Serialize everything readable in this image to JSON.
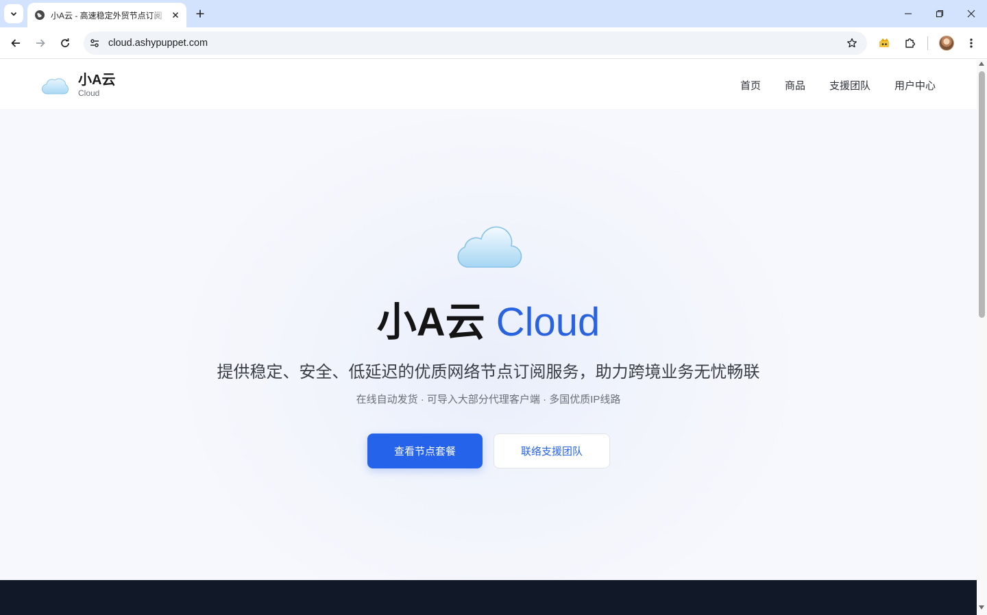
{
  "browser": {
    "tab_title": "小A云 - 高速稳定外贸节点订阅",
    "url": "cloud.ashypuppet.com"
  },
  "icons": {
    "tab_list": "chevron-down-icon",
    "favicon": "globe-icon",
    "close": "close-icon",
    "new_tab": "plus-icon",
    "back": "arrow-left-icon",
    "forward": "arrow-right-icon",
    "reload": "reload-icon",
    "site_info": "tune-icon",
    "bookmark": "star-icon",
    "extension_1": "extension-icon",
    "extensions": "puzzle-icon",
    "menu": "kebab-menu-icon",
    "logo": "cloud-icon"
  },
  "site": {
    "brand_name": "小A云",
    "brand_sub": "Cloud",
    "nav": [
      "首页",
      "商品",
      "支援团队",
      "用户中心"
    ]
  },
  "hero": {
    "title_cn": "小A云",
    "title_en": "Cloud",
    "subtitle": "提供稳定、安全、低延迟的优质网络节点订阅服务，助力跨境业务无忧畅联",
    "note": "在线自动发货 · 可导入大部分代理客户端 · 多国优质IP线路",
    "primary_button": "查看节点套餐",
    "secondary_button": "联络支援团队"
  },
  "colors": {
    "tabbar_bg": "#d3e3fd",
    "accent": "#2563eb",
    "title_blue": "#2a63e0",
    "footer": "#111827"
  }
}
